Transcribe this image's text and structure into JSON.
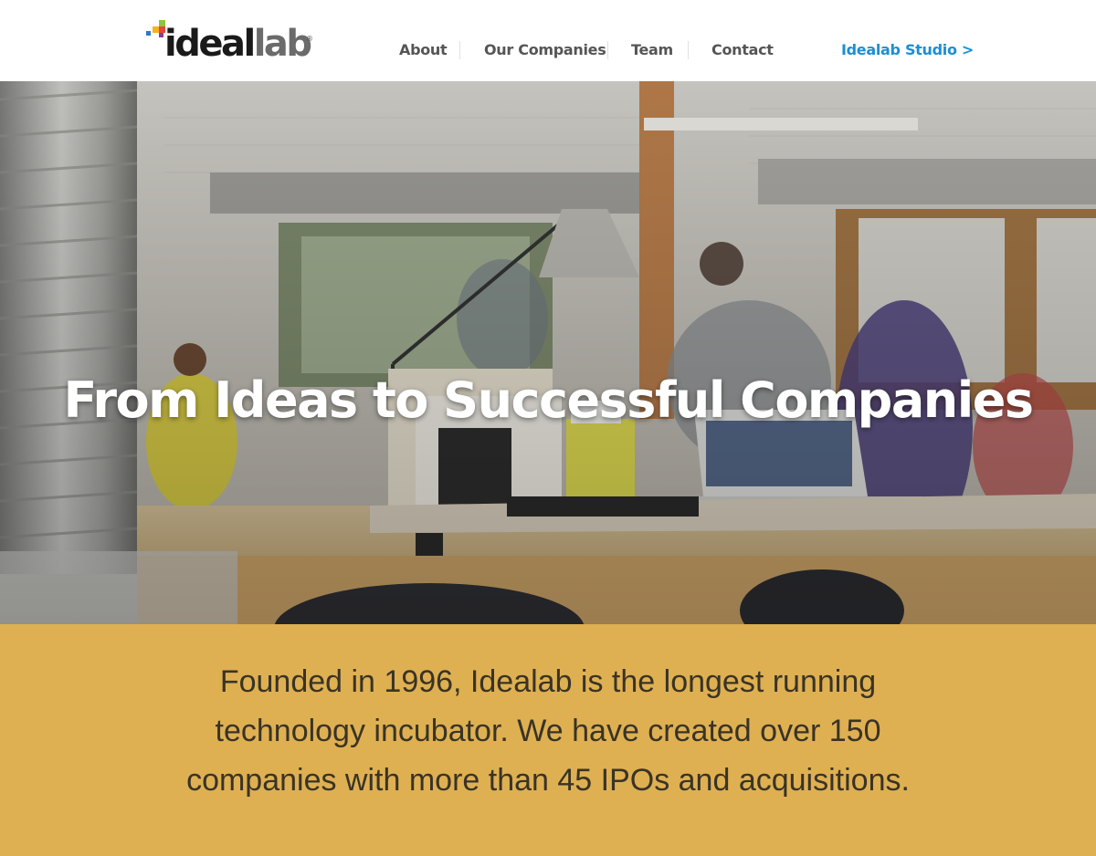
{
  "header": {
    "logo": {
      "text_main": "ideal",
      "text_accent": "lab",
      "registered": "®",
      "mark_colors": [
        "#e8463c",
        "#f3b321",
        "#3aa04a",
        "#2c7bc3",
        "#8c3b96"
      ]
    },
    "nav": [
      {
        "label": "About"
      },
      {
        "label": "Our Companies"
      },
      {
        "label": "Team"
      },
      {
        "label": "Contact"
      }
    ],
    "studio_link": "Idealab Studio >"
  },
  "hero": {
    "title": "From Ideas to Successful Companies"
  },
  "intro": {
    "lines": [
      "Founded in 1996, Idealab is the longest running",
      "technology incubator. We have created over 150",
      "companies with more than 45 IPOs and acquisitions."
    ]
  },
  "colors": {
    "nav_text": "#555555",
    "studio_link": "#1a8fd4",
    "intro_background": "#deb052",
    "intro_text": "#3a3325"
  }
}
